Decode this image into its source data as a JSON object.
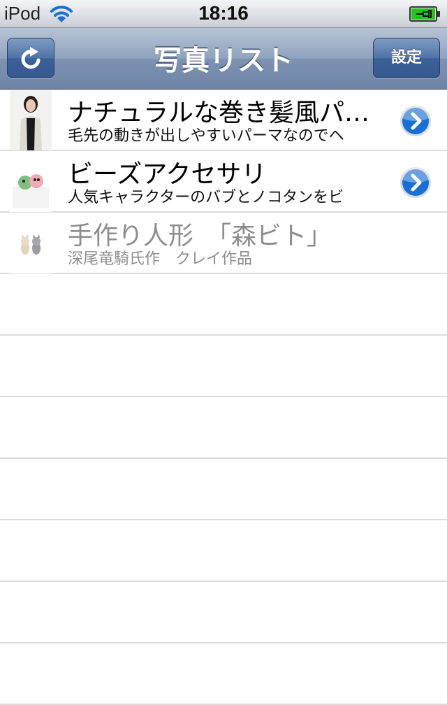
{
  "status_bar": {
    "device": "iPod",
    "time": "18:16"
  },
  "nav": {
    "title": "写真リスト",
    "settings_label": "設定"
  },
  "list": [
    {
      "title": "ナチュラルな巻き髪風パ…",
      "subtitle": "毛先の動きが出しやすいパーマなのでヘ",
      "enabled": true,
      "thumbnail": "woman-photo"
    },
    {
      "title": "ビーズアクセサリ",
      "subtitle": "人気キャラクターのバブとノコタンをビ",
      "enabled": true,
      "thumbnail": "beads-photo"
    },
    {
      "title": "手作り人形　「森ビト」",
      "subtitle": "深尾竜騎氏作　クレイ作品",
      "enabled": false,
      "thumbnail": "dolls-photo"
    }
  ],
  "colors": {
    "accent_blue": "#1a6fd6",
    "nav_bar": "#7e93b1",
    "battery_green": "#22c41c"
  }
}
